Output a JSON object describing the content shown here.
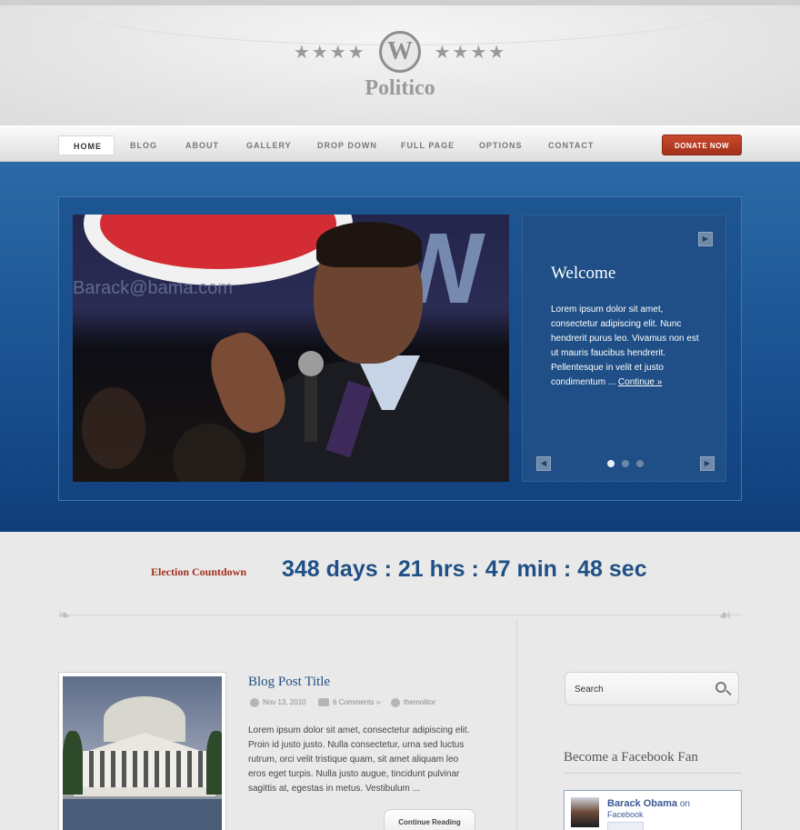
{
  "site": {
    "name": "Politico",
    "logo_letter": "W",
    "stars_left": "★★★★",
    "stars_right": "★★★★"
  },
  "nav": {
    "items": [
      {
        "label": "HOME",
        "active": true
      },
      {
        "label": "BLOG"
      },
      {
        "label": "ABOUT"
      },
      {
        "label": "GALLERY"
      },
      {
        "label": "DROP DOWN"
      },
      {
        "label": "FULL PAGE"
      },
      {
        "label": "OPTIONS"
      },
      {
        "label": "CONTACT"
      }
    ],
    "donate_label": "DONATE NOW"
  },
  "slider": {
    "title": "Welcome",
    "text": "Lorem ipsum dolor sit amet, consectetur adipiscing elit. Nunc hendrerit purus leo. Vivamus non est ut mauris faucibus hendrerit. Pellentesque in velit et justo condimentum ... ",
    "link": "Continue »",
    "photo_text": "Barack@bama.com",
    "active_slide": 1,
    "slide_count": 3,
    "prev_icon": "◀",
    "next_icon": "▶"
  },
  "countdown": {
    "label": "Election Countdown",
    "value": "348 days : 21 hrs : 47 min : 48 sec"
  },
  "post": {
    "title": "Blog Post Title",
    "date": "Nov 13, 2010",
    "comments": "6 Comments ››",
    "author": "themolitor",
    "body": "Lorem ipsum dolor sit amet, consectetur adipiscing elit. Proin id justo justo. Nulla consectetur, urna sed luctus rutrum, orci velit tristique quam, sit amet aliquam leo eros eget turpis. Nulla justo augue, tincidunt pulvinar sagittis at, egestas in metus. Vestibulum ...",
    "continue_label": "Continue Reading"
  },
  "sidebar": {
    "search_value": "Search",
    "facebook_heading": "Become a Facebook Fan",
    "fb_name": "Barack Obama",
    "fb_on": " on",
    "fb_sub": "Facebook"
  },
  "colors": {
    "accent_blue": "#1f4f86",
    "donate_red": "#b23a22",
    "countdown_label": "#a2311e"
  }
}
